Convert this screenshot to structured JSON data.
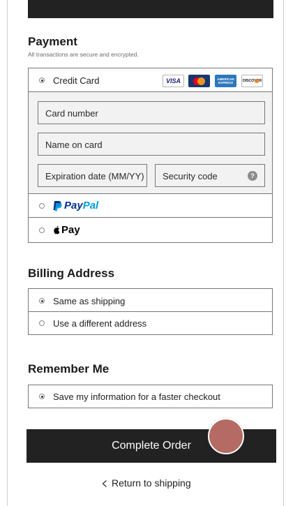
{
  "payment": {
    "title": "Payment",
    "subtitle": "All transactions are secure and encrypted.",
    "credit_card": {
      "label": "Credit Card",
      "selected": true,
      "card_brands": [
        "VISA",
        "Mastercard",
        "American Express",
        "Discover"
      ],
      "visa_text": "VISA",
      "amex_text_1": "AMERICAN",
      "amex_text_2": "EXPRESS",
      "discover_text": "DISCOVER",
      "fields": {
        "card_number_placeholder": "Card number",
        "name_placeholder": "Name on card",
        "expiration_placeholder": "Expiration date (MM/YY)",
        "security_code_placeholder": "Security code",
        "help_glyph": "?"
      }
    },
    "paypal": {
      "label_pay": "Pay",
      "label_pal": "Pal",
      "selected": false
    },
    "apple_pay": {
      "label": "Pay",
      "selected": false
    }
  },
  "billing": {
    "title": "Billing Address",
    "options": [
      {
        "label": "Same as shipping",
        "selected": true
      },
      {
        "label": "Use a different address",
        "selected": false
      }
    ]
  },
  "remember": {
    "title": "Remember Me",
    "option": {
      "label": "Save my information for a faster checkout",
      "selected": true
    }
  },
  "actions": {
    "complete_order": "Complete Order",
    "return_link": "Return to shipping"
  },
  "colors": {
    "button_bg": "#222222",
    "paypal_blue_dark": "#003087",
    "paypal_blue_light": "#009cde",
    "touch_indicator": "#b56a63"
  }
}
